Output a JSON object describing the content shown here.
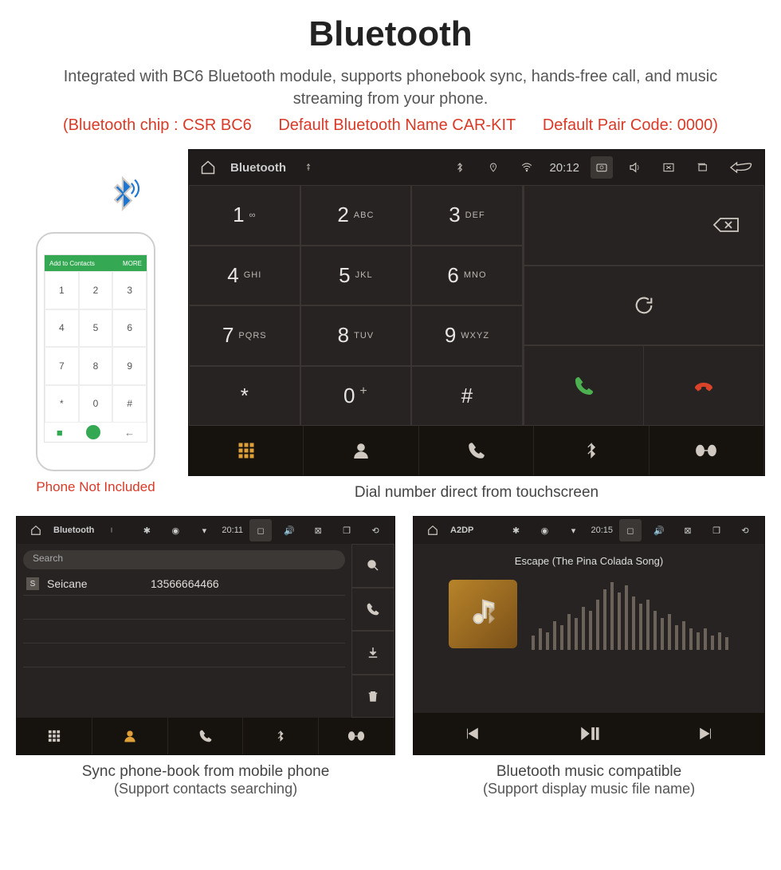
{
  "title": "Bluetooth",
  "subtitle": "Integrated with BC6 Bluetooth module, supports phonebook sync, hands-free call, and music streaming from your phone.",
  "spec": {
    "chip": "(Bluetooth chip : CSR BC6",
    "name": "Default Bluetooth Name CAR-KIT",
    "pair": "Default Pair Code: 0000)"
  },
  "phone": {
    "top_label": "Add to Contacts",
    "top_right": "MORE",
    "caption": "Phone Not Included"
  },
  "hu_main": {
    "title": "Bluetooth",
    "time": "20:12",
    "keys": [
      {
        "n": "1",
        "s": "∞"
      },
      {
        "n": "2",
        "s": "ABC"
      },
      {
        "n": "3",
        "s": "DEF"
      },
      {
        "n": "4",
        "s": "GHI"
      },
      {
        "n": "5",
        "s": "JKL"
      },
      {
        "n": "6",
        "s": "MNO"
      },
      {
        "n": "7",
        "s": "PQRS"
      },
      {
        "n": "8",
        "s": "TUV"
      },
      {
        "n": "9",
        "s": "WXYZ"
      },
      {
        "n": "*",
        "s": ""
      },
      {
        "n": "0",
        "s": "+"
      },
      {
        "n": "#",
        "s": ""
      }
    ],
    "caption": "Dial number direct from touchscreen"
  },
  "hu_contacts": {
    "title": "Bluetooth",
    "time": "20:11",
    "search": "Search",
    "contact_name": "Seicane",
    "contact_number": "13566664466",
    "badge": "S",
    "caption1": "Sync phone-book from mobile phone",
    "caption2": "(Support contacts searching)"
  },
  "hu_music": {
    "title": "A2DP",
    "time": "20:15",
    "song": "Escape (The Pina Colada Song)",
    "caption1": "Bluetooth music compatible",
    "caption2": "(Support display music file name)"
  }
}
